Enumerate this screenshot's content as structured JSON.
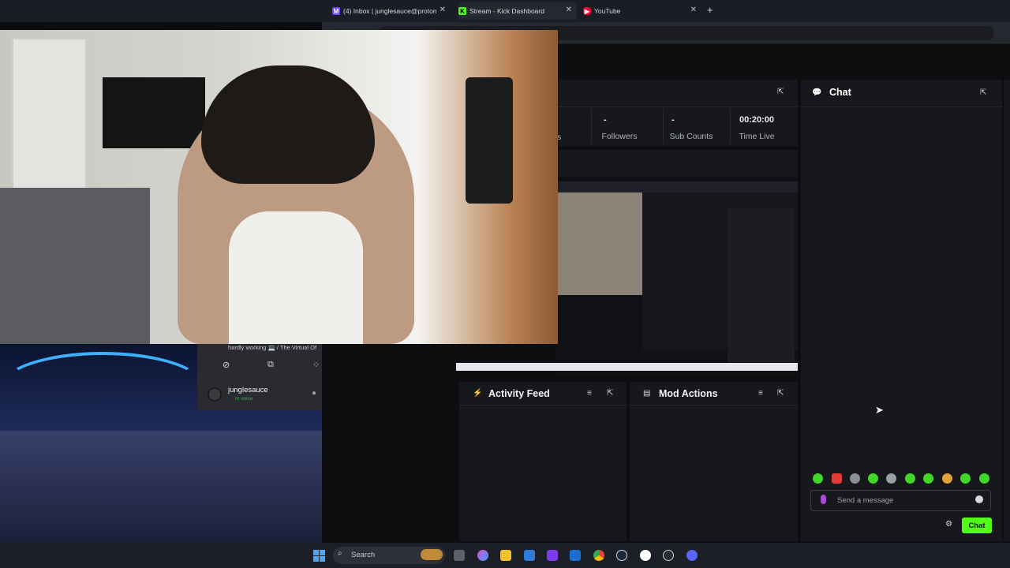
{
  "browser": {
    "tabs": [
      {
        "label": "(4) Inbox | junglesauce@proton",
        "icon": "proton-mail-icon"
      },
      {
        "label": "Stream - Kick Dashboard",
        "icon": "kick-icon",
        "active": true
      },
      {
        "label": "YouTube",
        "icon": "youtube-icon"
      }
    ],
    "close_glyph": "✕",
    "new_tab_glyph": "+"
  },
  "stats": {
    "partial_label": "s",
    "followers_value": "-",
    "followers_label": "Followers",
    "subs_value": "-",
    "subs_label": "Sub Counts",
    "time_value": "00:20:00",
    "time_label": "Time Live"
  },
  "panels": {
    "activity_title": "Activity Feed",
    "mod_title": "Mod Actions"
  },
  "chat": {
    "title": "Chat",
    "placeholder": "Send a message",
    "send_label": "Chat"
  },
  "discord": {
    "status": "hardly working 💻 / The Virtual Of",
    "username": "junglesauce",
    "voice_status": "In voice"
  },
  "taskbar": {
    "search_placeholder": "Search"
  },
  "colors": {
    "kick_green": "#53fc18",
    "panel_bg": "#17181c",
    "page_bg": "#0d0e10"
  }
}
